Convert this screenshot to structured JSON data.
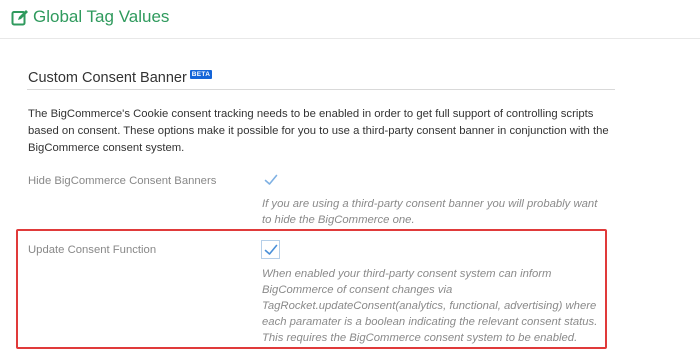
{
  "header": {
    "title": "Global Tag Values",
    "icon": "edit-icon",
    "color": "#2f9a5d"
  },
  "section": {
    "title": "Custom Consent Banner",
    "badge": "BETA",
    "description": "The BigCommerce's Cookie consent tracking needs to be enabled in order to get full support of controlling scripts based on consent. These options make it possible for you to use a third-party consent banner in conjunction with the BigCommerce consent system."
  },
  "settings": [
    {
      "label": "Hide BigCommerce Consent Banners",
      "checked": true,
      "help_lines": [
        "If you are using a third-party consent banner you will probably want",
        "to hide the BigCommerce one."
      ]
    },
    {
      "label": "Update Consent Function",
      "checked": true,
      "help_lines": [
        "When enabled your third-party consent system can inform",
        "BigCommerce of consent changes via",
        "TagRocket.updateConsent(analytics, functional, advertising) where",
        "each paramater is a boolean indicating the relevant consent status.",
        "This requires the BigCommerce consent system to be enabled."
      ]
    }
  ],
  "colors": {
    "accent": "#2f9a5d",
    "checkmark": "#4a90d9",
    "highlight": "#e03a3a",
    "beta_badge": "#1565d8"
  }
}
